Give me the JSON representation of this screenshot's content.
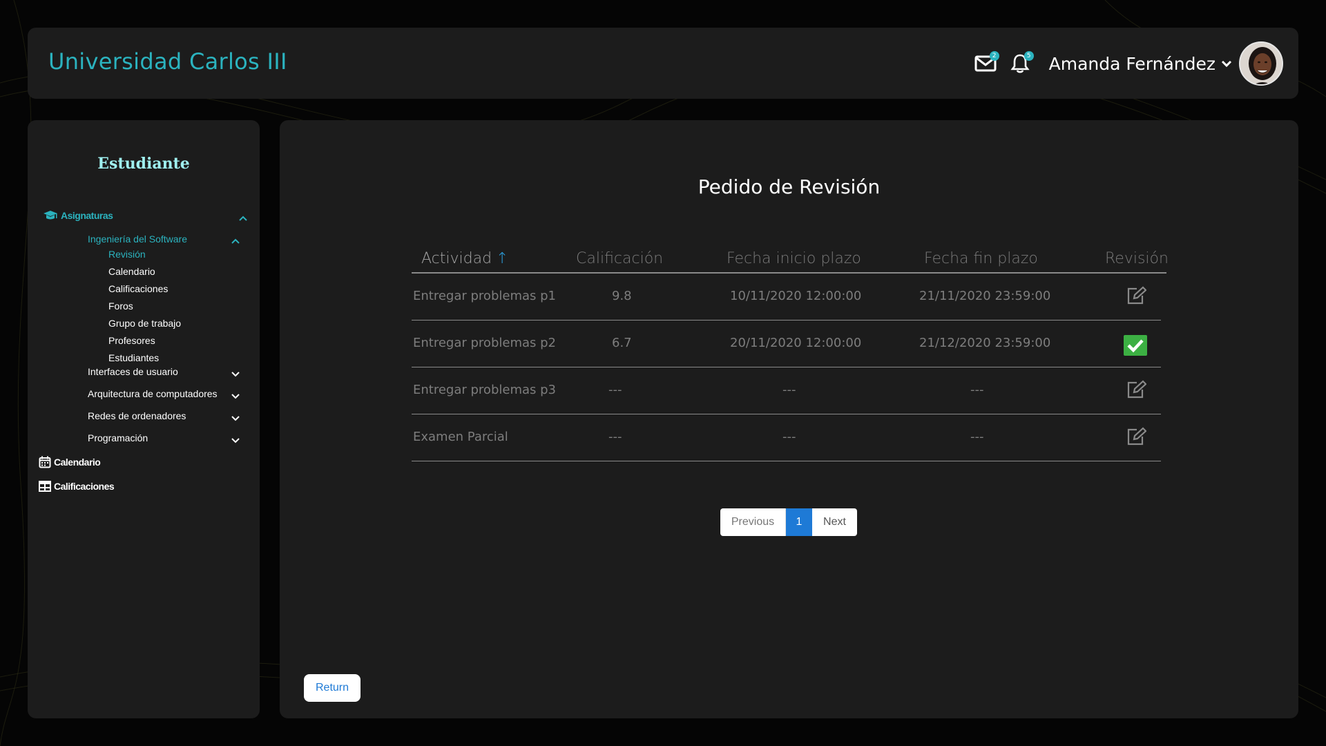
{
  "header": {
    "brand": "Universidad Carlos III",
    "mail_count": "2",
    "notif_count": "5",
    "user_name": "Amanda Fernández"
  },
  "sidebar": {
    "role": "Estudiante",
    "sections": [
      {
        "label": "Asignaturas",
        "icon": "graduation-cap-icon"
      },
      {
        "label": "Calendario",
        "icon": "calendar-icon"
      },
      {
        "label": "Calificaciones",
        "icon": "table-icon"
      }
    ],
    "subjects": [
      {
        "label": "Ingeniería del Software"
      },
      {
        "label": "Interfaces de usuario"
      },
      {
        "label": "Arquitectura de computadores"
      },
      {
        "label": "Redes de ordenadores"
      },
      {
        "label": "Programación"
      }
    ],
    "leaves": [
      "Revisión",
      "Calendario",
      "Calificaciones",
      "Foros",
      "Grupo de trabajo",
      "Profesores",
      "Estudiantes"
    ]
  },
  "main": {
    "title": "Pedido de Revisión",
    "columns": [
      "Actividad",
      "Calificación",
      "Fecha inicio plazo",
      "Fecha fin plazo",
      "Revisión"
    ],
    "sort_arrow": "↑",
    "rows": [
      {
        "actividad": "Entregar problemas p1",
        "calificacion": "9.8",
        "inicio": "10/11/2020  12:00:00",
        "fin": "21/11/2020  23:59:00",
        "revision": "edit"
      },
      {
        "actividad": "Entregar problemas p2",
        "calificacion": "6.7",
        "inicio": "20/11/2020  12:00:00",
        "fin": "21/12/2020  23:59:00",
        "revision": "done"
      },
      {
        "actividad": "Entregar problemas p3",
        "calificacion": "---",
        "inicio": "---",
        "fin": "---",
        "revision": "edit"
      },
      {
        "actividad": "Examen Parcial",
        "calificacion": "---",
        "inicio": "---",
        "fin": "---",
        "revision": "edit"
      }
    ],
    "pager": {
      "prev": "Previous",
      "current": "1",
      "next": "Next"
    },
    "return_label": "Return"
  },
  "colors": {
    "accent": "#2bb3bf",
    "primary": "#1e7ad6",
    "success": "#3cb043"
  }
}
